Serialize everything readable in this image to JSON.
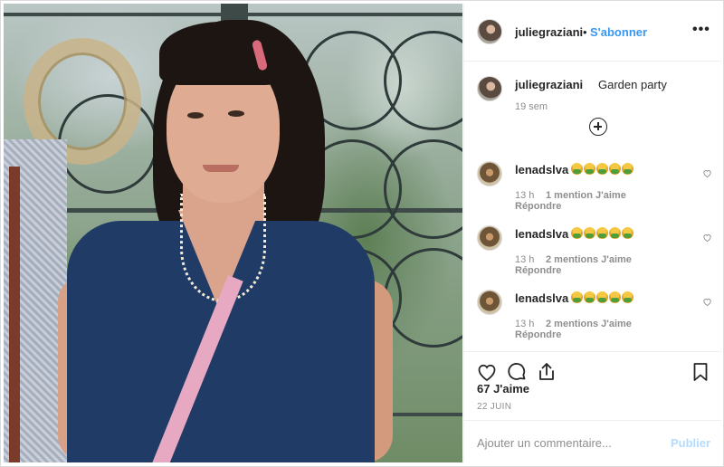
{
  "post": {
    "author": "juliegraziani",
    "follow_label": "S'abonner",
    "separator": "•",
    "more_label": "•••"
  },
  "caption": {
    "author": "juliegraziani",
    "text": "Garden party",
    "time": "19 sem"
  },
  "comments": [
    {
      "author": "lenadslva",
      "emoji_count": 5,
      "emoji_name": "nauseated-face-emoji",
      "time": "13 h",
      "likes": "1 mention J'aime",
      "reply": "Répondre"
    },
    {
      "author": "lenadslva",
      "emoji_count": 5,
      "emoji_name": "nauseated-face-emoji",
      "time": "13 h",
      "likes": "2 mentions J'aime",
      "reply": "Répondre"
    },
    {
      "author": "lenadslva",
      "emoji_count": 5,
      "emoji_name": "nauseated-face-emoji",
      "time": "13 h",
      "likes": "2 mentions J'aime",
      "reply": "Répondre"
    }
  ],
  "engagement": {
    "likes": "67 J'aime",
    "date": "22 JUIN"
  },
  "add_comment": {
    "placeholder": "Ajouter un commentaire...",
    "publish_label": "Publier"
  },
  "icons": {
    "like": "heart-icon",
    "comment": "comment-bubble-icon",
    "share": "share-icon",
    "save": "bookmark-icon",
    "load_more": "plus-circle-icon"
  },
  "colors": {
    "accent": "#3897f0",
    "publish_disabled": "#b3dbff",
    "text": "#262626",
    "muted": "#8e8e8e",
    "border": "#efefef"
  }
}
